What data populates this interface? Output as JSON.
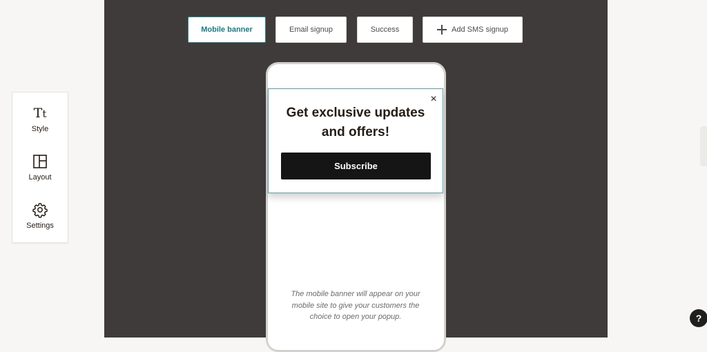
{
  "tabs": {
    "mobile_banner": "Mobile banner",
    "email_signup": "Email signup",
    "success": "Success",
    "add_sms_signup": "Add SMS signup",
    "active": "Mobile banner"
  },
  "tool_panel": {
    "style_label": "Style",
    "layout_label": "Layout",
    "settings_label": "Settings",
    "style_icon": "text-style-icon",
    "layout_icon": "layout-icon",
    "settings_icon": "gear-icon"
  },
  "banner": {
    "headline": "Get exclusive updates and offers!",
    "button_label": "Subscribe",
    "close_symbol": "×"
  },
  "phone_note": "The mobile banner will appear on your mobile site to give your customers the choice to open your popup.",
  "help": {
    "label": "?"
  },
  "colors": {
    "canvas": "#403b3b",
    "accent": "#2f8b8f",
    "button": "#151515"
  }
}
